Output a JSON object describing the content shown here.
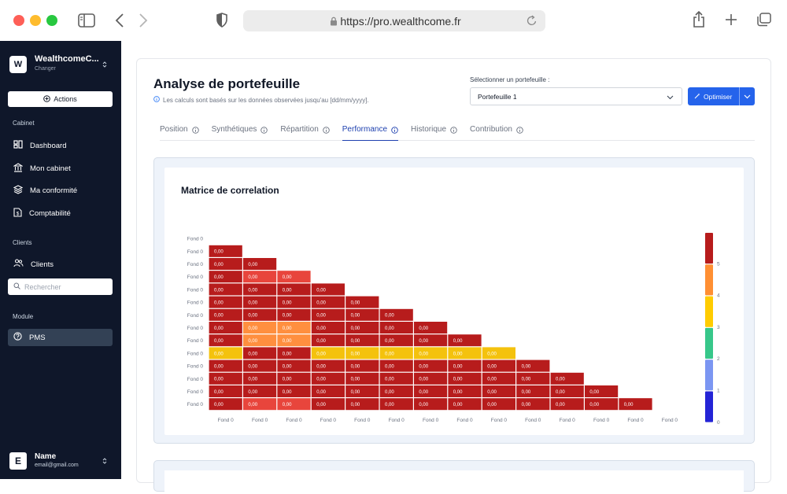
{
  "browser": {
    "url": "https://pro.wealthcome.fr"
  },
  "sidebar": {
    "workspace": {
      "initial": "W",
      "name": "WealthcomeC...",
      "sub": "Changer"
    },
    "actions_label": "Actions",
    "sections": {
      "cabinet": "Cabinet",
      "clients": "Clients",
      "module": "Module"
    },
    "items": {
      "dashboard": "Dashboard",
      "mon_cabinet": "Mon cabinet",
      "conformite": "Ma conformité",
      "comptabilite": "Comptabilité",
      "clients": "Clients",
      "pms": "PMS"
    },
    "search_placeholder": "Rechercher",
    "user": {
      "initial": "E",
      "name": "Name",
      "email": "email@gmail.com"
    }
  },
  "header": {
    "title": "Analyse de portefeuille",
    "subtitle": "Les calculs sont basés sur les données observées jusqu'au [dd/mm/yyyy].",
    "select_label": "Sélectionner un portefeuille :",
    "select_value": "Portefeuille 1",
    "optimize_label": "Optimiser"
  },
  "tabs": [
    "Position",
    "Synthétiques",
    "Répartition",
    "Performance",
    "Historique",
    "Contribution"
  ],
  "active_tab": "Performance",
  "chart_data": {
    "type": "heatmap",
    "title": "Matrice de correlation",
    "row_labels": [
      "Fond 0",
      "Fond 0",
      "Fond 0",
      "Fond 0",
      "Fond 0",
      "Fond 0",
      "Fond 0",
      "Fond 0",
      "Fond 0",
      "Fond 0",
      "Fond 0",
      "Fond 0",
      "Fond 0",
      "Fond 0"
    ],
    "col_labels": [
      "Fond 0",
      "Fond 0",
      "Fond 0",
      "Fond 0",
      "Fond 0",
      "Fond 0",
      "Fond 0",
      "Fond 0",
      "Fond 0",
      "Fond 0",
      "Fond 0",
      "Fond 0",
      "Fond 0",
      "Fond 0"
    ],
    "cell_text": "0,00",
    "color_levels": [
      [],
      [
        5
      ],
      [
        5,
        5
      ],
      [
        5,
        4.5,
        4.5
      ],
      [
        5,
        5,
        5,
        5
      ],
      [
        5,
        5,
        5,
        5,
        5
      ],
      [
        5,
        5,
        5,
        5,
        5,
        5
      ],
      [
        5,
        4,
        4,
        5,
        5,
        5,
        5
      ],
      [
        5,
        4,
        4,
        5,
        5,
        5,
        5,
        5
      ],
      [
        3,
        5,
        5,
        3,
        3,
        3,
        3,
        3,
        3
      ],
      [
        5,
        5,
        5,
        5,
        5,
        5,
        5,
        5,
        5,
        5
      ],
      [
        5,
        5,
        5,
        5,
        5,
        5,
        5,
        5,
        5,
        5,
        5
      ],
      [
        5,
        5,
        5,
        5,
        5,
        5,
        5,
        5,
        5,
        5,
        5,
        5
      ],
      [
        5,
        4.5,
        4.5,
        5,
        5,
        5,
        5,
        5,
        5,
        5,
        5,
        5,
        5
      ]
    ],
    "colorbar": {
      "ticks": [
        0,
        1,
        2,
        3,
        4,
        5
      ],
      "colors": [
        "#2424d6",
        "#7b96f2",
        "#37c78a",
        "#ffcc00",
        "#ff8f33",
        "#b71c1c"
      ]
    },
    "level_colors": {
      "3": "#f4c20d",
      "4": "#ff8f3f",
      "4.5": "#e8453c",
      "5": "#b71c1c"
    }
  }
}
